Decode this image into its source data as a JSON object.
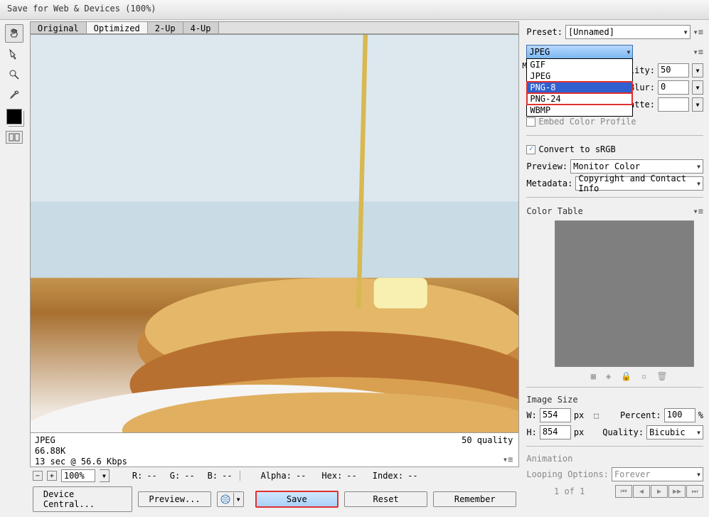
{
  "window": {
    "title": "Save for Web & Devices (100%)"
  },
  "tabs": {
    "original": "Original",
    "optimized": "Optimized",
    "two_up": "2-Up",
    "four_up": "4-Up"
  },
  "info": {
    "format": "JPEG",
    "size": "66.88K",
    "speed": "13 sec @ 56.6 Kbps",
    "quality": "50 quality"
  },
  "status": {
    "zoom": "100%",
    "r": "R:",
    "g": "G:",
    "b": "B:",
    "rdash": "--",
    "gdash": "--",
    "bdash": "--",
    "alpha": "Alpha:",
    "alphadash": "--",
    "hex": "Hex:",
    "hexdash": "--",
    "index": "Index:",
    "indexdash": "--"
  },
  "buttons": {
    "device_central": "Device Central...",
    "preview": "Preview...",
    "save": "Save",
    "reset": "Reset",
    "remember": "Remember"
  },
  "preset": {
    "label": "Preset:",
    "value": "[Unnamed]"
  },
  "format": {
    "selected": "JPEG",
    "opt_gif": "GIF",
    "opt_jpeg": "JPEG",
    "opt_png8": "PNG-8",
    "opt_png24": "PNG-24",
    "opt_wbmp": "WBMP"
  },
  "quality": {
    "label": "uality:",
    "value": "50"
  },
  "blur": {
    "label": "Blur:",
    "value": "0"
  },
  "optimized": {
    "label": "Optimized"
  },
  "matte": {
    "label": "Matte:"
  },
  "embed": {
    "label": "Embed Color Profile"
  },
  "srgb": {
    "label": "Convert to sRGB"
  },
  "prev": {
    "label": "Preview:",
    "value": "Monitor Color"
  },
  "metadata": {
    "label": "Metadata:",
    "value": "Copyright and Contact Info"
  },
  "color_table": {
    "title": "Color Table"
  },
  "image_size": {
    "title": "Image Size",
    "w": "W:",
    "wval": "554",
    "px1": "px",
    "h": "H:",
    "hval": "854",
    "px2": "px",
    "percent": "Percent:",
    "pval": "100",
    "pct": "%",
    "quality": "Quality:",
    "qval": "Bicubic"
  },
  "animation": {
    "title": "Animation",
    "looping": "Looping Options:",
    "loopval": "Forever",
    "frame": "1 of 1"
  },
  "m_letter": "M"
}
